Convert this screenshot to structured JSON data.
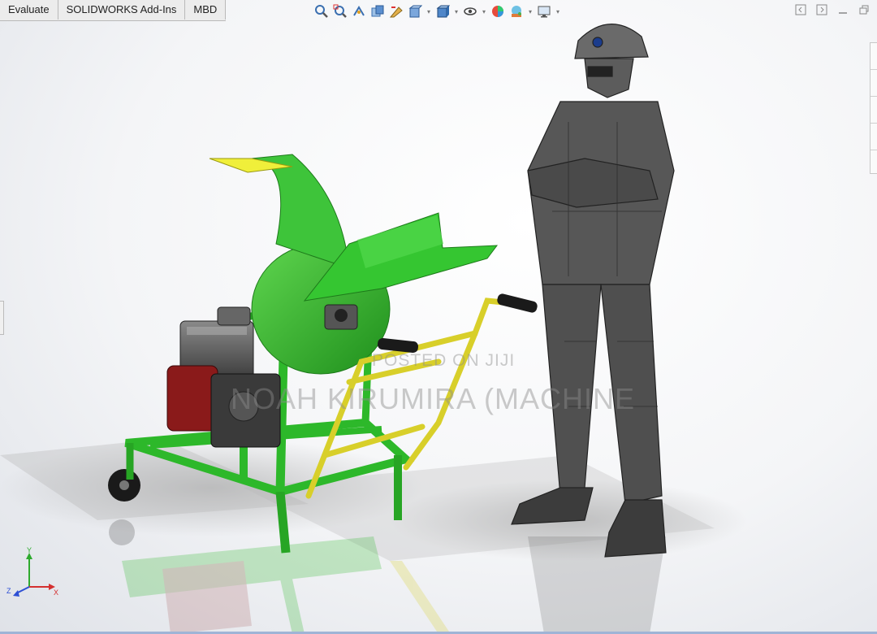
{
  "tabs": [
    {
      "label": "Evaluate"
    },
    {
      "label": "SOLIDWORKS Add-Ins"
    },
    {
      "label": "MBD"
    }
  ],
  "heads_up_toolbar": {
    "icons": [
      "zoom-to-fit-icon",
      "zoom-to-area-icon",
      "previous-view-icon",
      "section-view-icon",
      "dynamic-annotation-icon",
      "view-orientation-icon",
      "display-style-icon",
      "hide-show-icon",
      "edit-appearance-icon",
      "apply-scene-icon",
      "view-settings-icon"
    ]
  },
  "watermark": {
    "line1": "POSTED ON JIJI",
    "line2": "NOAH KIRUMIRA (MACHINE"
  },
  "triad": {
    "x": "X",
    "y": "Y",
    "z": "Z"
  },
  "colors": {
    "machine_green": "#2db82a",
    "handle_yellow": "#d8cf2a",
    "hopper_lid": "#f0ef3a",
    "engine_red": "#8a1a1a",
    "figure_gray": "#555555"
  }
}
